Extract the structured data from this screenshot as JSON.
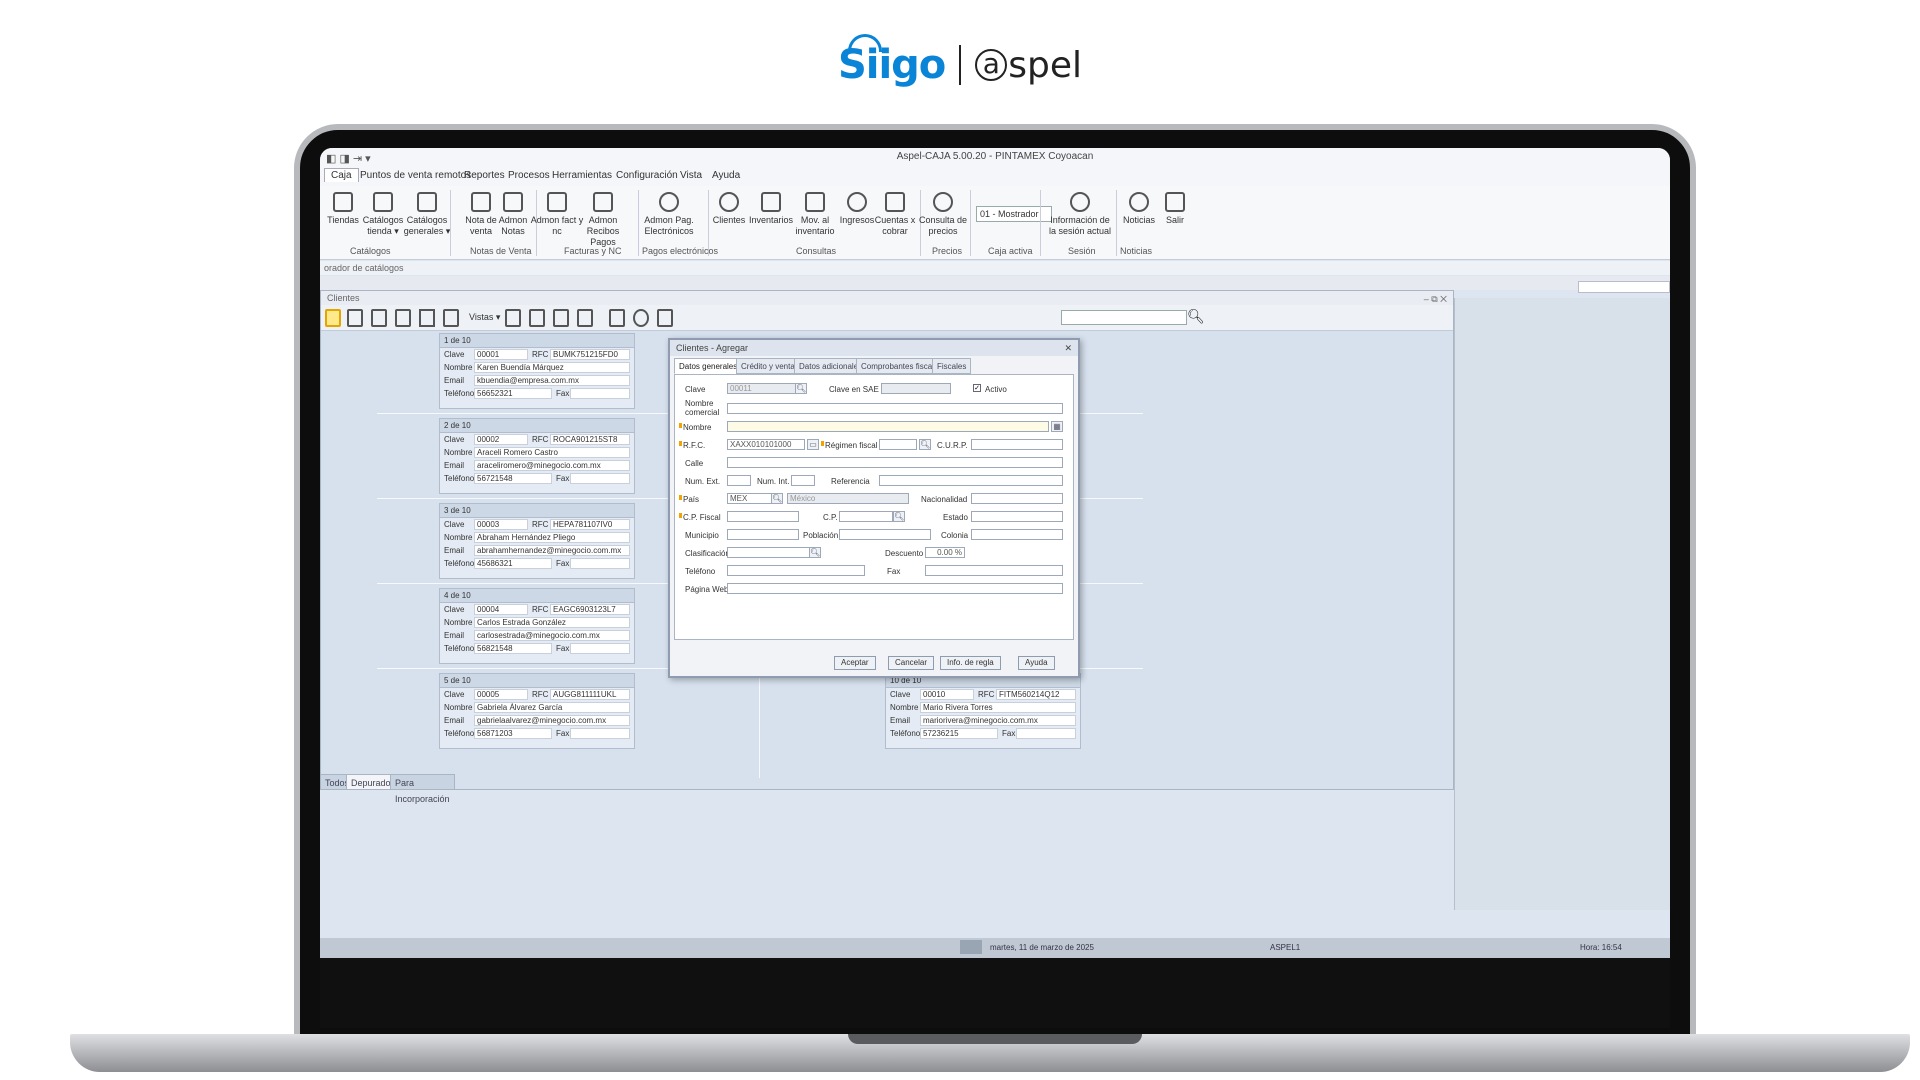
{
  "brand": {
    "siigo": "Siigo",
    "aspel": "aspel",
    "aspel_a": "a"
  },
  "window": {
    "title": "Aspel-CAJA 5.00.20 - PINTAMEX Coyoacan",
    "quick_access": "◧ ◨ ⇥ ▾"
  },
  "menu": [
    "Caja",
    "Puntos de venta remotos",
    "Reportes",
    "Procesos",
    "Herramientas",
    "Configuración",
    "Vista",
    "Ayuda"
  ],
  "ribbon": {
    "buttons": [
      {
        "label": "Tiendas",
        "icon": "store-icon"
      },
      {
        "label": "Catálogos tienda ▾",
        "icon": "catalog-icon"
      },
      {
        "label": "Catálogos generales ▾",
        "icon": "catalog-general-icon"
      },
      {
        "label": "Nota de venta",
        "icon": "sale-note-icon"
      },
      {
        "label": "Admon Notas",
        "icon": "notes-admin-icon"
      },
      {
        "label": "Admon fact y nc",
        "icon": "invoice-admin-icon"
      },
      {
        "label": "Admon Recibos Pagos",
        "icon": "receipts-icon"
      },
      {
        "label": "Admon Pag. Electrónicos",
        "icon": "electronic-payments-icon"
      },
      {
        "label": "Clientes",
        "icon": "clients-icon"
      },
      {
        "label": "Inventarios",
        "icon": "inventory-icon"
      },
      {
        "label": "Mov. al inventario",
        "icon": "inventory-move-icon"
      },
      {
        "label": "Ingresos",
        "icon": "income-icon"
      },
      {
        "label": "Cuentas x cobrar",
        "icon": "receivables-icon"
      },
      {
        "label": "Consulta de precios",
        "icon": "price-lookup-icon"
      },
      {
        "label": "Información de la sesión actual",
        "icon": "session-info-icon"
      },
      {
        "label": "Noticias",
        "icon": "bell-icon"
      },
      {
        "label": "Salir",
        "icon": "exit-icon"
      }
    ],
    "groups": [
      "Catálogos",
      "Notas de Venta",
      "Facturas y NC",
      "Pagos electrónicos",
      "Consultas",
      "Precios",
      "Caja activa",
      "Sesión",
      "Noticias"
    ],
    "caja_select": "01 - Mostrador"
  },
  "catalog_bar": "orador de catálogos",
  "clients_window": {
    "title": "Clientes",
    "controls": "–  ⧉  ✕",
    "vistas_label": "Vistas ▾"
  },
  "cards": [
    {
      "header": "1 de 10",
      "clave": "00001",
      "rfc": "BUMK751215FD0",
      "nombre": "Karen Buendía Márquez",
      "email": "kbuendia@empresa.com.mx",
      "telefono": "56652321"
    },
    {
      "header": "2 de 10",
      "clave": "00002",
      "rfc": "ROCA901215ST8",
      "nombre": "Araceli Romero Castro",
      "email": "araceliromero@minegocio.com.mx",
      "telefono": "56721548"
    },
    {
      "header": "3 de 10",
      "clave": "00003",
      "rfc": "HEPA781107IV0",
      "nombre": "Abraham Hernández Pliego",
      "email": "abrahamhernandez@minegocio.com.mx",
      "telefono": "45686321"
    },
    {
      "header": "4 de 10",
      "clave": "00004",
      "rfc": "EAGC6903123L7",
      "nombre": "Carlos Estrada González",
      "email": "carlosestrada@minegocio.com.mx",
      "telefono": "56821548"
    },
    {
      "header": "5 de 10",
      "clave": "00005",
      "rfc": "AUGG811111UKL",
      "nombre": "Gabriela Álvarez García",
      "email": "gabrielaalvarez@minegocio.com.mx",
      "telefono": "56871203"
    },
    {
      "header": "10 de 10",
      "clave": "00010",
      "rfc": "FITM560214Q12",
      "nombre": "Mario Rivera Torres",
      "email": "mariorivera@minegocio.com.mx",
      "telefono": "57236215"
    }
  ],
  "card_labels": {
    "clave": "Clave",
    "rfc": "RFC",
    "nombre": "Nombre",
    "email": "Email",
    "telefono": "Teléfono",
    "fax": "Fax"
  },
  "bottom_tabs": [
    "Todos",
    "Depurado",
    "Para Incorporación"
  ],
  "statusbar": {
    "date": "martes, 11 de marzo de 2025",
    "user": "ASPEL1",
    "time": "Hora: 16:54"
  },
  "dialog": {
    "title": "Clientes - Agregar",
    "close": "✕",
    "tabs": [
      "Datos generales",
      "Crédito y ventas",
      "Datos adicionales",
      "Comprobantes fiscales",
      "Fiscales"
    ],
    "labels": {
      "clave": "Clave",
      "clave_sae": "Clave en SAE",
      "activo": "Activo",
      "nombre_comercial": "Nombre comercial",
      "nombre": "Nombre",
      "rfc": "R.F.C.",
      "regimen": "Régimen fiscal",
      "curp": "C.U.R.P.",
      "calle": "Calle",
      "num_ext": "Num. Ext.",
      "num_int": "Num. Int.",
      "referencia": "Referencia",
      "pais": "País",
      "nacionalidad": "Nacionalidad",
      "cp_fiscal": "C.P. Fiscal",
      "cp": "C.P.",
      "estado": "Estado",
      "municipio": "Municipio",
      "poblacion": "Población",
      "colonia": "Colonia",
      "clasificacion": "Clasificación",
      "descuento": "Descuento",
      "telefono": "Teléfono",
      "fax": "Fax",
      "pagina_web": "Página Web"
    },
    "values": {
      "clave": "00011",
      "rfc": "XAXX010101000",
      "pais": "MEX",
      "pais_nombre": "México",
      "descuento": "0.00 %",
      "activo_check": "✓"
    },
    "buttons": [
      "Aceptar",
      "Cancelar",
      "Info. de regla",
      "Ayuda"
    ]
  }
}
